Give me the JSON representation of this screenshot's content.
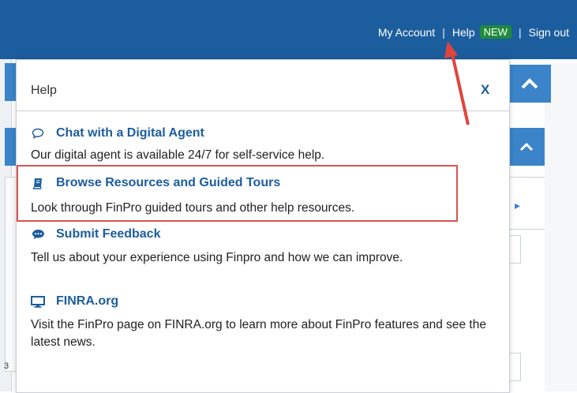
{
  "topnav": {
    "my_account": "My Account",
    "sep1": "|",
    "help": "Help",
    "new_badge": "NEW",
    "sep2": "|",
    "sign_out": "Sign out"
  },
  "help_popup": {
    "title": "Help",
    "close": "X",
    "items": [
      {
        "icon": "chat-bubble-icon",
        "title": "Chat with a Digital Agent",
        "description": "Our digital agent is available 24/7 for self-service help."
      },
      {
        "icon": "book-icon",
        "title": "Browse Resources and Guided Tours",
        "description": "Look through FinPro guided tours and other help resources."
      },
      {
        "icon": "comment-icon",
        "title": "Submit Feedback",
        "description": "Tell us about your experience using Finpro and how we can improve."
      },
      {
        "icon": "monitor-icon",
        "title": "FINRA.org",
        "description": "Visit the FinPro page on FINRA.org to learn more about FinPro features and see the latest news."
      }
    ]
  },
  "background": {
    "left_number": "3"
  },
  "colors": {
    "header_blue": "#1c5d9e",
    "link_blue": "#1c5d9e",
    "badge_green": "#1f8b3b",
    "highlight_red": "#d9534f"
  }
}
